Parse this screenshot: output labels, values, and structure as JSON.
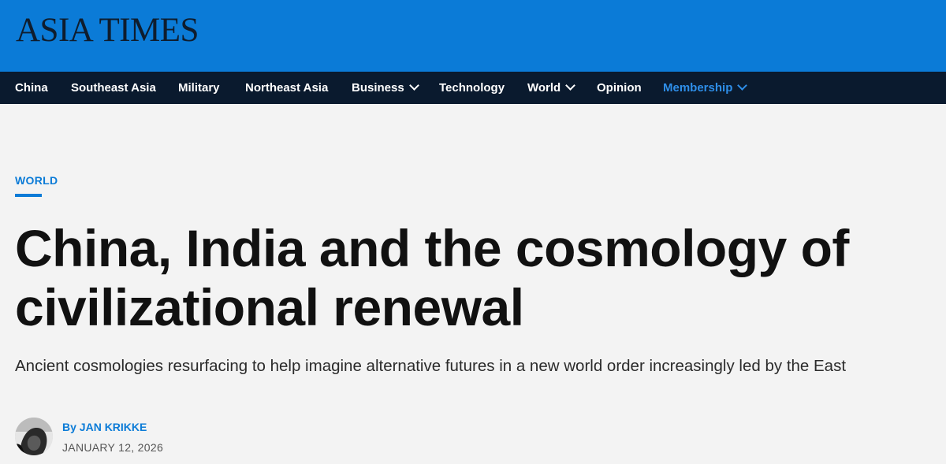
{
  "site": {
    "logo_text": "ASIA TIMES"
  },
  "nav": {
    "items": [
      {
        "label": "China",
        "has_dropdown": false
      },
      {
        "label": "Southeast Asia",
        "has_dropdown": false
      },
      {
        "label": "Military",
        "has_dropdown": false
      },
      {
        "label": "Northeast Asia",
        "has_dropdown": false
      },
      {
        "label": "Business",
        "has_dropdown": true
      },
      {
        "label": "Technology",
        "has_dropdown": false
      },
      {
        "label": "World",
        "has_dropdown": true
      },
      {
        "label": "Opinion",
        "has_dropdown": false
      },
      {
        "label": "Membership",
        "has_dropdown": true,
        "accent": true
      }
    ]
  },
  "article": {
    "category": "WORLD",
    "headline": "China, India and the cosmology of civilizational renewal",
    "subheadline": "Ancient cosmologies resurfacing to help imagine alternative futures in a new world order increasingly led by the East",
    "byline_prefix": "By",
    "author": "JAN KRIKKE",
    "date": "JANUARY 12, 2026"
  },
  "colors": {
    "brand_blue": "#0b7bd7",
    "nav_background": "#0a1a2e",
    "page_background": "#f3f3f3",
    "headline_text": "#111111"
  }
}
